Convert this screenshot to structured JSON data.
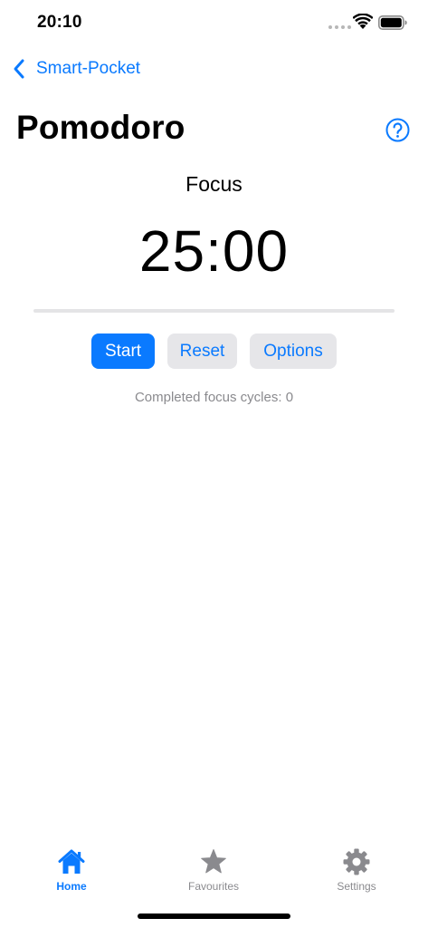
{
  "status_bar": {
    "time": "20:10"
  },
  "nav": {
    "back_label": "Smart-Pocket"
  },
  "page": {
    "title": "Pomodoro"
  },
  "timer": {
    "mode": "Focus",
    "display": "25:00",
    "progress": 0
  },
  "controls": {
    "start_label": "Start",
    "reset_label": "Reset",
    "options_label": "Options"
  },
  "stats": {
    "cycles_text": "Completed focus cycles: 0"
  },
  "tab_bar": {
    "home_label": "Home",
    "favourites_label": "Favourites",
    "settings_label": "Settings",
    "active_tab": "home"
  },
  "colors": {
    "accent": "#0a7aff",
    "inactive": "#8a8a8e",
    "button_secondary_bg": "#e6e6e9"
  },
  "icons": {
    "back": "chevron-left-icon",
    "help": "question-circle-icon",
    "home": "house-icon",
    "favourites": "star-icon",
    "settings": "gear-icon",
    "wifi": "wifi-icon",
    "battery": "battery-icon"
  }
}
